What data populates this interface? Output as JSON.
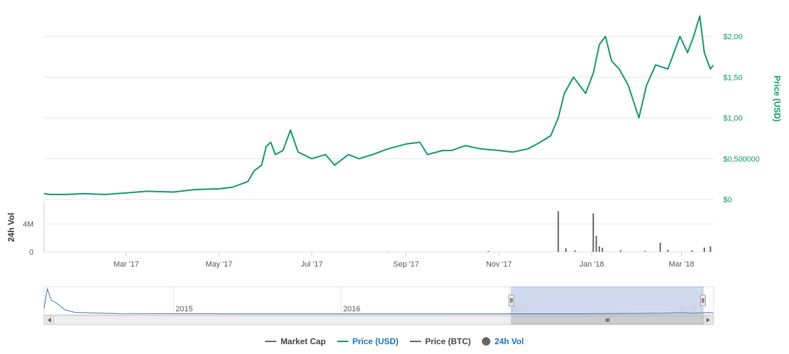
{
  "chart_data": {
    "type": "line",
    "price_axis": {
      "label": "Price (USD)",
      "ticks": [
        "$0",
        "$0,500000",
        "$1,00",
        "$1,50",
        "$2,00"
      ],
      "tick_values": [
        0,
        0.5,
        1.0,
        1.5,
        2.0
      ],
      "ylim": [
        0,
        2.0
      ]
    },
    "volume_axis": {
      "label": "24h Vol",
      "ticks": [
        "0",
        "4M"
      ],
      "tick_values": [
        0,
        4000000
      ],
      "ylim": [
        0,
        6000000
      ]
    },
    "x_ticks": [
      "Mar '17",
      "May '17",
      "Jul '17",
      "Sep '17",
      "Nov '17",
      "Jan '18",
      "Mar '18"
    ],
    "x_tick_dates": [
      "2017-03-01",
      "2017-05-01",
      "2017-07-01",
      "2017-09-01",
      "2017-11-01",
      "2018-01-01",
      "2018-03-01"
    ],
    "series": [
      {
        "name": "Price (USD)",
        "color": "#0c9a68",
        "points": [
          [
            "2017-01-06",
            0.07
          ],
          [
            "2017-01-10",
            0.06
          ],
          [
            "2017-01-20",
            0.06
          ],
          [
            "2017-02-01",
            0.07
          ],
          [
            "2017-02-15",
            0.06
          ],
          [
            "2017-03-01",
            0.08
          ],
          [
            "2017-03-15",
            0.1
          ],
          [
            "2017-04-01",
            0.09
          ],
          [
            "2017-04-15",
            0.12
          ],
          [
            "2017-05-01",
            0.13
          ],
          [
            "2017-05-10",
            0.15
          ],
          [
            "2017-05-20",
            0.22
          ],
          [
            "2017-05-24",
            0.35
          ],
          [
            "2017-05-29",
            0.42
          ],
          [
            "2017-06-01",
            0.65
          ],
          [
            "2017-06-04",
            0.7
          ],
          [
            "2017-06-07",
            0.55
          ],
          [
            "2017-06-12",
            0.6
          ],
          [
            "2017-06-17",
            0.85
          ],
          [
            "2017-06-22",
            0.58
          ],
          [
            "2017-07-01",
            0.5
          ],
          [
            "2017-07-10",
            0.55
          ],
          [
            "2017-07-16",
            0.42
          ],
          [
            "2017-07-25",
            0.55
          ],
          [
            "2017-08-01",
            0.5
          ],
          [
            "2017-08-10",
            0.55
          ],
          [
            "2017-08-20",
            0.62
          ],
          [
            "2017-09-01",
            0.68
          ],
          [
            "2017-09-10",
            0.7
          ],
          [
            "2017-09-15",
            0.55
          ],
          [
            "2017-09-25",
            0.6
          ],
          [
            "2017-10-01",
            0.6
          ],
          [
            "2017-10-10",
            0.66
          ],
          [
            "2017-10-20",
            0.62
          ],
          [
            "2017-11-01",
            0.6
          ],
          [
            "2017-11-10",
            0.58
          ],
          [
            "2017-11-20",
            0.62
          ],
          [
            "2017-11-28",
            0.7
          ],
          [
            "2017-12-05",
            0.78
          ],
          [
            "2017-12-10",
            1.0
          ],
          [
            "2017-12-14",
            1.3
          ],
          [
            "2017-12-20",
            1.5
          ],
          [
            "2017-12-28",
            1.3
          ],
          [
            "2018-01-02",
            1.55
          ],
          [
            "2018-01-06",
            1.9
          ],
          [
            "2018-01-10",
            2.0
          ],
          [
            "2018-01-14",
            1.7
          ],
          [
            "2018-01-19",
            1.6
          ],
          [
            "2018-01-25",
            1.4
          ],
          [
            "2018-02-01",
            1.0
          ],
          [
            "2018-02-06",
            1.4
          ],
          [
            "2018-02-12",
            1.65
          ],
          [
            "2018-02-20",
            1.6
          ],
          [
            "2018-02-28",
            2.0
          ],
          [
            "2018-03-05",
            1.8
          ],
          [
            "2018-03-09",
            2.0
          ],
          [
            "2018-03-13",
            2.25
          ],
          [
            "2018-03-16",
            1.8
          ],
          [
            "2018-03-20",
            1.6
          ],
          [
            "2018-03-22",
            1.65
          ]
        ]
      },
      {
        "name": "24h Vol",
        "color": "#666666",
        "points": [
          [
            "2017-08-20",
            20000
          ],
          [
            "2017-10-25",
            120000
          ],
          [
            "2017-12-10",
            5800000
          ],
          [
            "2017-12-15",
            500000
          ],
          [
            "2017-12-21",
            200000
          ],
          [
            "2018-01-02",
            5500000
          ],
          [
            "2018-01-04",
            2300000
          ],
          [
            "2018-01-06",
            800000
          ],
          [
            "2018-01-08",
            600000
          ],
          [
            "2018-01-20",
            250000
          ],
          [
            "2018-02-05",
            150000
          ],
          [
            "2018-02-15",
            1300000
          ],
          [
            "2018-02-20",
            300000
          ],
          [
            "2018-03-08",
            200000
          ],
          [
            "2018-03-16",
            600000
          ],
          [
            "2018-03-20",
            800000
          ]
        ]
      }
    ],
    "navigator": {
      "year_labels": [
        "2015",
        "2016",
        "2017",
        "2018"
      ],
      "year_dates": [
        "2015-01-01",
        "2016-01-01",
        "2017-01-01",
        "2018-01-01"
      ],
      "selected_range": [
        "2017-01-06",
        "2018-03-22"
      ]
    },
    "legend": [
      {
        "label": "Market Cap",
        "color": "#666666",
        "marker": "line",
        "active": false
      },
      {
        "label": "Price (USD)",
        "color": "#0c9a68",
        "marker": "line",
        "active": true
      },
      {
        "label": "Price (BTC)",
        "color": "#666666",
        "marker": "line",
        "active": false
      },
      {
        "label": "24h Vol",
        "color": "#666666",
        "marker": "dot",
        "active": true
      }
    ],
    "legend_position": "bottom",
    "grid": true
  }
}
